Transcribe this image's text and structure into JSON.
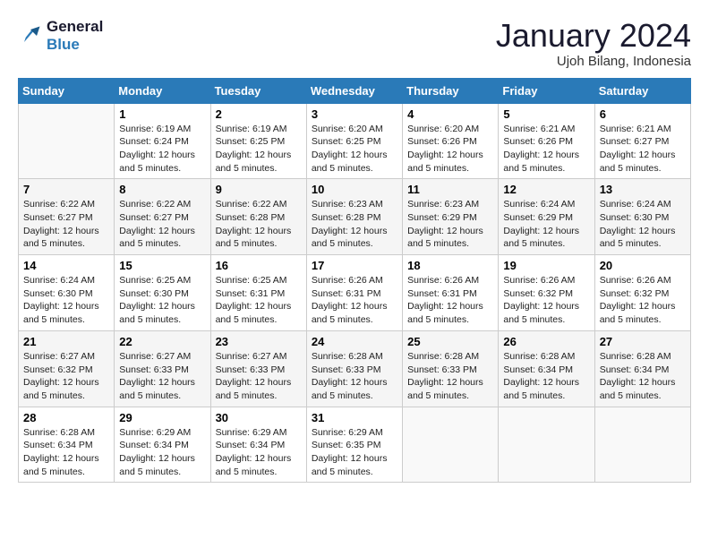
{
  "logo": {
    "line1": "General",
    "line2": "Blue"
  },
  "title": "January 2024",
  "location": "Ujoh Bilang, Indonesia",
  "weekdays": [
    "Sunday",
    "Monday",
    "Tuesday",
    "Wednesday",
    "Thursday",
    "Friday",
    "Saturday"
  ],
  "weeks": [
    [
      {
        "num": "",
        "sunrise": "",
        "sunset": "",
        "daylight": ""
      },
      {
        "num": "1",
        "sunrise": "Sunrise: 6:19 AM",
        "sunset": "Sunset: 6:24 PM",
        "daylight": "Daylight: 12 hours and 5 minutes."
      },
      {
        "num": "2",
        "sunrise": "Sunrise: 6:19 AM",
        "sunset": "Sunset: 6:25 PM",
        "daylight": "Daylight: 12 hours and 5 minutes."
      },
      {
        "num": "3",
        "sunrise": "Sunrise: 6:20 AM",
        "sunset": "Sunset: 6:25 PM",
        "daylight": "Daylight: 12 hours and 5 minutes."
      },
      {
        "num": "4",
        "sunrise": "Sunrise: 6:20 AM",
        "sunset": "Sunset: 6:26 PM",
        "daylight": "Daylight: 12 hours and 5 minutes."
      },
      {
        "num": "5",
        "sunrise": "Sunrise: 6:21 AM",
        "sunset": "Sunset: 6:26 PM",
        "daylight": "Daylight: 12 hours and 5 minutes."
      },
      {
        "num": "6",
        "sunrise": "Sunrise: 6:21 AM",
        "sunset": "Sunset: 6:27 PM",
        "daylight": "Daylight: 12 hours and 5 minutes."
      }
    ],
    [
      {
        "num": "7",
        "sunrise": "Sunrise: 6:22 AM",
        "sunset": "Sunset: 6:27 PM",
        "daylight": "Daylight: 12 hours and 5 minutes."
      },
      {
        "num": "8",
        "sunrise": "Sunrise: 6:22 AM",
        "sunset": "Sunset: 6:27 PM",
        "daylight": "Daylight: 12 hours and 5 minutes."
      },
      {
        "num": "9",
        "sunrise": "Sunrise: 6:22 AM",
        "sunset": "Sunset: 6:28 PM",
        "daylight": "Daylight: 12 hours and 5 minutes."
      },
      {
        "num": "10",
        "sunrise": "Sunrise: 6:23 AM",
        "sunset": "Sunset: 6:28 PM",
        "daylight": "Daylight: 12 hours and 5 minutes."
      },
      {
        "num": "11",
        "sunrise": "Sunrise: 6:23 AM",
        "sunset": "Sunset: 6:29 PM",
        "daylight": "Daylight: 12 hours and 5 minutes."
      },
      {
        "num": "12",
        "sunrise": "Sunrise: 6:24 AM",
        "sunset": "Sunset: 6:29 PM",
        "daylight": "Daylight: 12 hours and 5 minutes."
      },
      {
        "num": "13",
        "sunrise": "Sunrise: 6:24 AM",
        "sunset": "Sunset: 6:30 PM",
        "daylight": "Daylight: 12 hours and 5 minutes."
      }
    ],
    [
      {
        "num": "14",
        "sunrise": "Sunrise: 6:24 AM",
        "sunset": "Sunset: 6:30 PM",
        "daylight": "Daylight: 12 hours and 5 minutes."
      },
      {
        "num": "15",
        "sunrise": "Sunrise: 6:25 AM",
        "sunset": "Sunset: 6:30 PM",
        "daylight": "Daylight: 12 hours and 5 minutes."
      },
      {
        "num": "16",
        "sunrise": "Sunrise: 6:25 AM",
        "sunset": "Sunset: 6:31 PM",
        "daylight": "Daylight: 12 hours and 5 minutes."
      },
      {
        "num": "17",
        "sunrise": "Sunrise: 6:26 AM",
        "sunset": "Sunset: 6:31 PM",
        "daylight": "Daylight: 12 hours and 5 minutes."
      },
      {
        "num": "18",
        "sunrise": "Sunrise: 6:26 AM",
        "sunset": "Sunset: 6:31 PM",
        "daylight": "Daylight: 12 hours and 5 minutes."
      },
      {
        "num": "19",
        "sunrise": "Sunrise: 6:26 AM",
        "sunset": "Sunset: 6:32 PM",
        "daylight": "Daylight: 12 hours and 5 minutes."
      },
      {
        "num": "20",
        "sunrise": "Sunrise: 6:26 AM",
        "sunset": "Sunset: 6:32 PM",
        "daylight": "Daylight: 12 hours and 5 minutes."
      }
    ],
    [
      {
        "num": "21",
        "sunrise": "Sunrise: 6:27 AM",
        "sunset": "Sunset: 6:32 PM",
        "daylight": "Daylight: 12 hours and 5 minutes."
      },
      {
        "num": "22",
        "sunrise": "Sunrise: 6:27 AM",
        "sunset": "Sunset: 6:33 PM",
        "daylight": "Daylight: 12 hours and 5 minutes."
      },
      {
        "num": "23",
        "sunrise": "Sunrise: 6:27 AM",
        "sunset": "Sunset: 6:33 PM",
        "daylight": "Daylight: 12 hours and 5 minutes."
      },
      {
        "num": "24",
        "sunrise": "Sunrise: 6:28 AM",
        "sunset": "Sunset: 6:33 PM",
        "daylight": "Daylight: 12 hours and 5 minutes."
      },
      {
        "num": "25",
        "sunrise": "Sunrise: 6:28 AM",
        "sunset": "Sunset: 6:33 PM",
        "daylight": "Daylight: 12 hours and 5 minutes."
      },
      {
        "num": "26",
        "sunrise": "Sunrise: 6:28 AM",
        "sunset": "Sunset: 6:34 PM",
        "daylight": "Daylight: 12 hours and 5 minutes."
      },
      {
        "num": "27",
        "sunrise": "Sunrise: 6:28 AM",
        "sunset": "Sunset: 6:34 PM",
        "daylight": "Daylight: 12 hours and 5 minutes."
      }
    ],
    [
      {
        "num": "28",
        "sunrise": "Sunrise: 6:28 AM",
        "sunset": "Sunset: 6:34 PM",
        "daylight": "Daylight: 12 hours and 5 minutes."
      },
      {
        "num": "29",
        "sunrise": "Sunrise: 6:29 AM",
        "sunset": "Sunset: 6:34 PM",
        "daylight": "Daylight: 12 hours and 5 minutes."
      },
      {
        "num": "30",
        "sunrise": "Sunrise: 6:29 AM",
        "sunset": "Sunset: 6:34 PM",
        "daylight": "Daylight: 12 hours and 5 minutes."
      },
      {
        "num": "31",
        "sunrise": "Sunrise: 6:29 AM",
        "sunset": "Sunset: 6:35 PM",
        "daylight": "Daylight: 12 hours and 5 minutes."
      },
      {
        "num": "",
        "sunrise": "",
        "sunset": "",
        "daylight": ""
      },
      {
        "num": "",
        "sunrise": "",
        "sunset": "",
        "daylight": ""
      },
      {
        "num": "",
        "sunrise": "",
        "sunset": "",
        "daylight": ""
      }
    ]
  ]
}
